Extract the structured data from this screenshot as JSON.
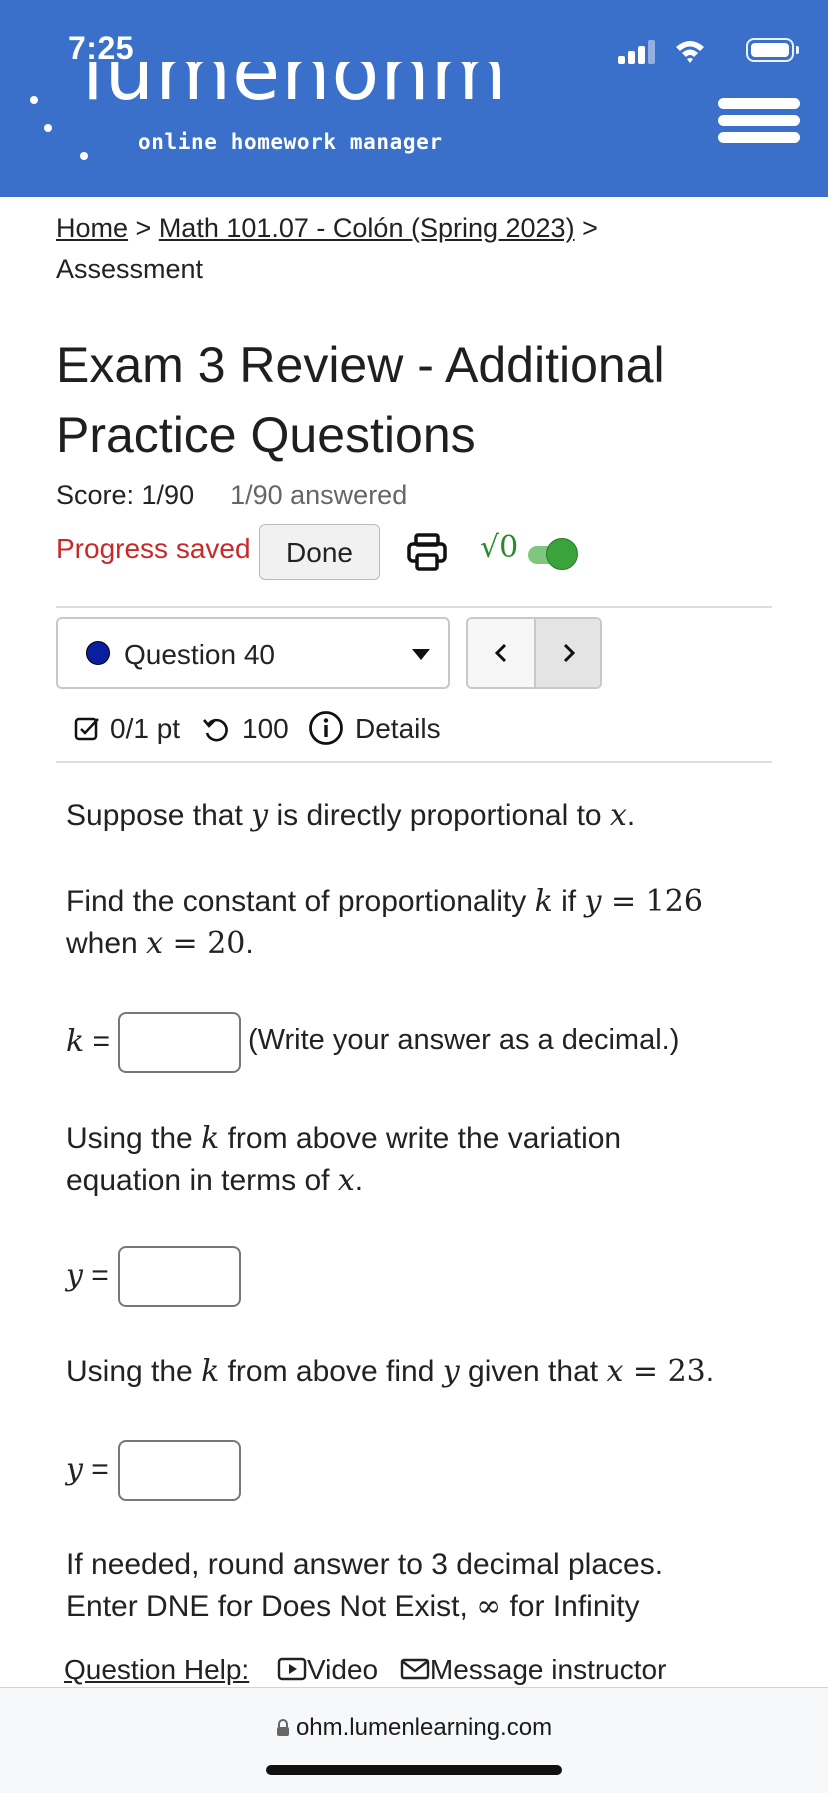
{
  "status_bar": {
    "time": "7:25"
  },
  "header": {
    "logo_text": "lumenohm",
    "logo_tagline": "online homework manager"
  },
  "breadcrumb": {
    "home": "Home",
    "sep1": " > ",
    "course": "Math 101.07 - Colón (Spring 2023)",
    "sep2": " > ",
    "current": "Assessment"
  },
  "title": "Exam 3 Review - Additional Practice Questions",
  "score": {
    "score_text": "Score: 1/90",
    "answered_text": "1/90 answered"
  },
  "toolbar": {
    "progress_text": "Progress saved",
    "done_label": "Done",
    "math_toggle_label": "√0",
    "math_toggle_on": true
  },
  "question_nav": {
    "selected": "Question 40",
    "prev_label": "<",
    "next_label": ">"
  },
  "question_meta": {
    "points": "0/1 pt",
    "tries": "100",
    "details": "Details"
  },
  "question": {
    "intro_pre": "Suppose that ",
    "intro_y": "y",
    "intro_mid": " is directly proportional to ",
    "intro_x": "x",
    "intro_end": ".",
    "find_pre": "Find the constant of proportionality ",
    "find_k": "k",
    "find_if": " if ",
    "find_y": "y",
    "find_eq": " = ",
    "find_yval": "126",
    "find_when": "when ",
    "find_x": "x",
    "find_xval": "20",
    "k_label": "k",
    "answer_hint": "(Write your answer as a decimal.)",
    "part2_pre": "Using the ",
    "part2_k": "k",
    "part2_mid": " from above write the variation",
    "part2_line2": "equation in terms of ",
    "part2_x": "x",
    "y_label": "y",
    "part3_pre": "Using the ",
    "part3_k": "k",
    "part3_mid": " from above find ",
    "part3_y": "y",
    "part3_given": " given that ",
    "part3_x": "x",
    "part3_xval": "23",
    "round_note": "If needed, round answer to 3 decimal places.",
    "dne_note_pre": "Enter DNE for Does Not Exist, ",
    "dne_inf": "∞",
    "dne_note_post": " for Infinity",
    "answers": {
      "k": "",
      "y_equation": "",
      "y_value": ""
    }
  },
  "help": {
    "label": "Question Help:",
    "video": "Video",
    "message": "Message instructor"
  },
  "browser": {
    "url": "ohm.lumenlearning.com"
  }
}
